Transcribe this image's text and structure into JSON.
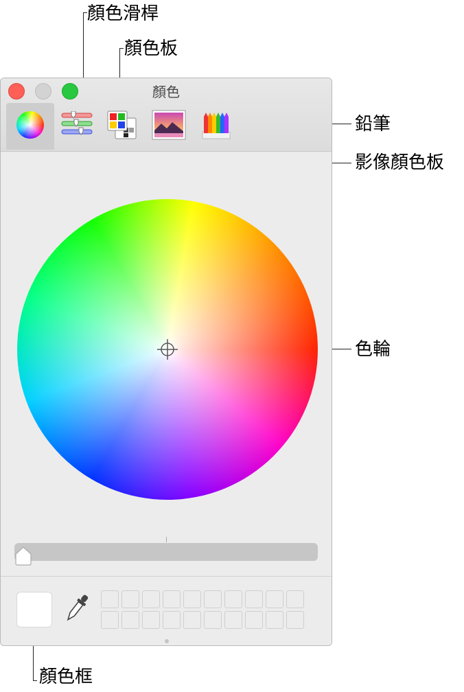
{
  "window": {
    "title": "顏色"
  },
  "toolbar": {
    "items": [
      {
        "id": "color-wheel",
        "active": true,
        "icon": "color-wheel-icon"
      },
      {
        "id": "color-sliders",
        "active": false,
        "icon": "sliders-icon"
      },
      {
        "id": "color-palettes",
        "active": false,
        "icon": "palette-icon"
      },
      {
        "id": "image-palettes",
        "active": false,
        "icon": "image-icon"
      },
      {
        "id": "pencils",
        "active": false,
        "icon": "pencils-icon"
      }
    ]
  },
  "callouts": {
    "color_sliders": "顏色滑桿",
    "color_palettes": "顏色板",
    "pencils": "鉛筆",
    "image_palettes": "影像顏色板",
    "color_wheel": "色輪",
    "color_well": "顏色框"
  },
  "brightness_slider": {
    "value": 0
  },
  "color_well": {
    "color": "#ffffff"
  },
  "swatches": {
    "rows": 2,
    "cols": 10
  },
  "colors": {
    "close": "#fe5f57",
    "minimize": "#d3d3d3",
    "zoom": "#28c840"
  }
}
